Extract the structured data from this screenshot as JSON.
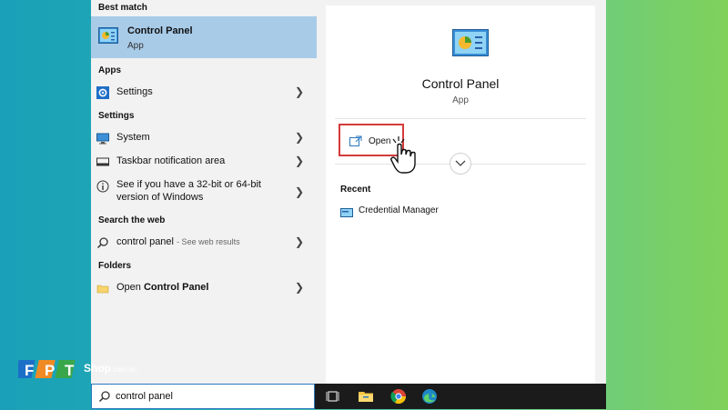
{
  "left_panel": {
    "best_match": {
      "heading": "Best match",
      "title": "Control Panel",
      "subtitle": "App",
      "icon": "control-panel-icon"
    },
    "apps": {
      "heading": "Apps",
      "items": [
        {
          "label": "Settings",
          "icon": "gear-icon"
        }
      ]
    },
    "settings": {
      "heading": "Settings",
      "items": [
        {
          "label": "System",
          "icon": "monitor-icon"
        },
        {
          "label": "Taskbar notification area",
          "icon": "taskbar-icon"
        },
        {
          "label": "See if you have a 32-bit or 64-bit version of Windows",
          "icon": "info-icon"
        }
      ]
    },
    "web": {
      "heading": "Search the web",
      "query": "control panel",
      "note": "- See web results"
    },
    "folders": {
      "heading": "Folders",
      "prefix": "Open ",
      "name": "Control Panel"
    }
  },
  "right_panel": {
    "title": "Control Panel",
    "subtitle": "App",
    "open_label": "Open",
    "recent_heading": "Recent",
    "recent_items": [
      {
        "label": "Credential Manager",
        "icon": "credential-manager-icon"
      }
    ]
  },
  "taskbar": {
    "search_value": "control panel",
    "icons": [
      "task-view-icon",
      "file-explorer-icon",
      "chrome-icon",
      "edge-icon"
    ]
  },
  "brand": {
    "logo": "FPT",
    "shop": "Shop",
    "domain": ".com.vn"
  },
  "colors": {
    "selection": "#a8cbe8",
    "highlight_border": "#d53a3a",
    "taskbar": "#1b1b1b",
    "accent": "#2a78c2"
  }
}
